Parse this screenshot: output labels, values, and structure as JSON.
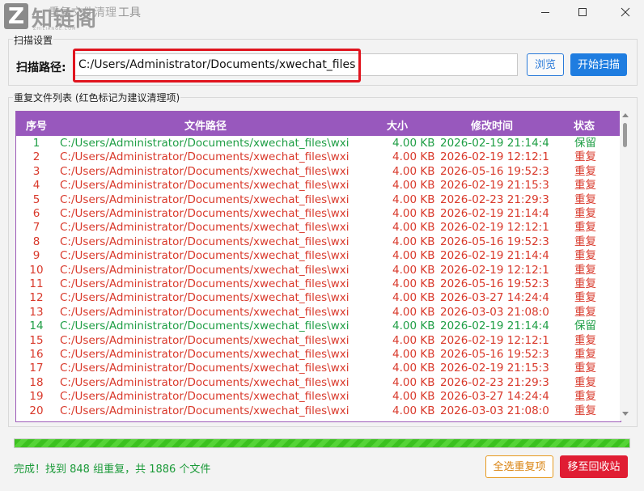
{
  "window": {
    "title_faded": "重复文件清理",
    "title_tail": "工具",
    "watermark_text": "知链阁",
    "watermark_sub": "ZHILIANGE.COM"
  },
  "scan_settings": {
    "group_title": "扫描设置",
    "path_label": "扫描路径:",
    "path_value": "C:/Users/Administrator/Documents/xwechat_files",
    "browse_label": "浏览",
    "scan_label": "开始扫描"
  },
  "file_list": {
    "group_title": "重复文件列表 (红色标记为建议清理项)",
    "columns": [
      "序号",
      "文件路径",
      "大小",
      "修改时间",
      "状态"
    ],
    "rows": [
      {
        "idx": "1",
        "path": "C:/Users/Administrator/Documents/xwechat_files\\wxi",
        "size": "4.00 KB",
        "time": "2026-02-19 21:14:4",
        "status": "保留",
        "keep": true
      },
      {
        "idx": "2",
        "path": "C:/Users/Administrator/Documents/xwechat_files\\wxi",
        "size": "4.00 KB",
        "time": "2026-02-19 12:12:1",
        "status": "重复",
        "keep": false
      },
      {
        "idx": "3",
        "path": "C:/Users/Administrator/Documents/xwechat_files\\wxi",
        "size": "4.00 KB",
        "time": "2026-05-16 19:52:3",
        "status": "重复",
        "keep": false
      },
      {
        "idx": "4",
        "path": "C:/Users/Administrator/Documents/xwechat_files\\wxi",
        "size": "4.00 KB",
        "time": "2026-02-19 21:15:3",
        "status": "重复",
        "keep": false
      },
      {
        "idx": "5",
        "path": "C:/Users/Administrator/Documents/xwechat_files\\wxi",
        "size": "4.00 KB",
        "time": "2026-02-23 21:29:3",
        "status": "重复",
        "keep": false
      },
      {
        "idx": "6",
        "path": "C:/Users/Administrator/Documents/xwechat_files\\wxi",
        "size": "4.00 KB",
        "time": "2026-02-19 21:14:4",
        "status": "重复",
        "keep": false
      },
      {
        "idx": "7",
        "path": "C:/Users/Administrator/Documents/xwechat_files\\wxi",
        "size": "4.00 KB",
        "time": "2026-02-19 12:12:1",
        "status": "重复",
        "keep": false
      },
      {
        "idx": "8",
        "path": "C:/Users/Administrator/Documents/xwechat_files\\wxi",
        "size": "4.00 KB",
        "time": "2026-05-16 19:52:3",
        "status": "重复",
        "keep": false
      },
      {
        "idx": "9",
        "path": "C:/Users/Administrator/Documents/xwechat_files\\wxi",
        "size": "4.00 KB",
        "time": "2026-02-19 21:14:4",
        "status": "重复",
        "keep": false
      },
      {
        "idx": "10",
        "path": "C:/Users/Administrator/Documents/xwechat_files\\wxi",
        "size": "4.00 KB",
        "time": "2026-02-19 12:12:1",
        "status": "重复",
        "keep": false
      },
      {
        "idx": "11",
        "path": "C:/Users/Administrator/Documents/xwechat_files\\wxi",
        "size": "4.00 KB",
        "time": "2026-05-16 19:52:3",
        "status": "重复",
        "keep": false
      },
      {
        "idx": "12",
        "path": "C:/Users/Administrator/Documents/xwechat_files\\wxi",
        "size": "4.00 KB",
        "time": "2026-03-27 14:24:4",
        "status": "重复",
        "keep": false
      },
      {
        "idx": "13",
        "path": "C:/Users/Administrator/Documents/xwechat_files\\wxi",
        "size": "4.00 KB",
        "time": "2026-03-03 21:08:0",
        "status": "重复",
        "keep": false
      },
      {
        "idx": "14",
        "path": "C:/Users/Administrator/Documents/xwechat_files\\wxi",
        "size": "4.00 KB",
        "time": "2026-02-19 21:14:4",
        "status": "保留",
        "keep": true
      },
      {
        "idx": "15",
        "path": "C:/Users/Administrator/Documents/xwechat_files\\wxi",
        "size": "4.00 KB",
        "time": "2026-02-19 12:12:1",
        "status": "重复",
        "keep": false
      },
      {
        "idx": "16",
        "path": "C:/Users/Administrator/Documents/xwechat_files\\wxi",
        "size": "4.00 KB",
        "time": "2026-05-16 19:52:3",
        "status": "重复",
        "keep": false
      },
      {
        "idx": "17",
        "path": "C:/Users/Administrator/Documents/xwechat_files\\wxi",
        "size": "4.00 KB",
        "time": "2026-02-19 21:15:3",
        "status": "重复",
        "keep": false
      },
      {
        "idx": "18",
        "path": "C:/Users/Administrator/Documents/xwechat_files\\wxi",
        "size": "4.00 KB",
        "time": "2026-02-23 21:29:3",
        "status": "重复",
        "keep": false
      },
      {
        "idx": "19",
        "path": "C:/Users/Administrator/Documents/xwechat_files\\wxi",
        "size": "4.00 KB",
        "time": "2026-03-27 14:24:4",
        "status": "重复",
        "keep": false
      },
      {
        "idx": "20",
        "path": "C:/Users/Administrator/Documents/xwechat_files\\wxi",
        "size": "4.00 KB",
        "time": "2026-03-03 21:08:0",
        "status": "重复",
        "keep": false
      }
    ]
  },
  "progress": {
    "fraction": 1.0
  },
  "status": {
    "text": "完成！找到 848 组重复，共 1886 个文件",
    "select_label": "全选重复项",
    "recycle_label": "移至回收站"
  },
  "colors": {
    "header_bg": "#9858bd",
    "keep": "#1f9e45",
    "duplicate": "#d9392b",
    "primary": "#1f7de0",
    "danger": "#e01d33",
    "warning": "#e79a1f",
    "highlight": "#e0141e",
    "progress": "#3bc11f"
  },
  "icons": {
    "window_controls": [
      "minimize-icon",
      "maximize-icon",
      "close-icon"
    ],
    "scroll": [
      "scroll-up-icon",
      "scroll-down-icon"
    ]
  }
}
